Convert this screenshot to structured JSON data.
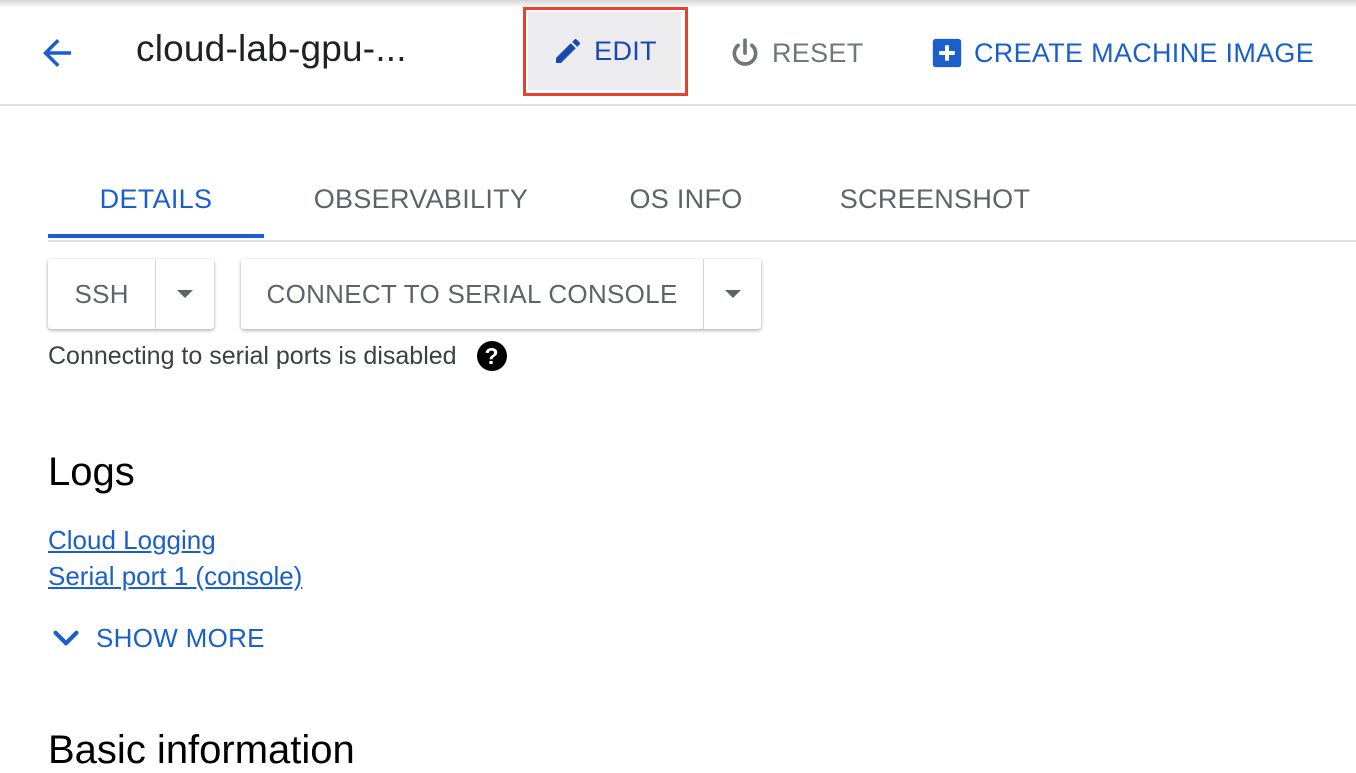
{
  "header": {
    "title": "cloud-lab-gpu-...",
    "back_icon": "arrow-back-icon",
    "actions": {
      "edit_label": "EDIT",
      "edit_icon": "pencil-icon",
      "reset_label": "RESET",
      "reset_icon": "power-icon",
      "create_label": "CREATE MACHINE IMAGE",
      "create_icon": "plus-box-icon"
    }
  },
  "tabs": [
    {
      "label": "DETAILS",
      "active": true
    },
    {
      "label": "OBSERVABILITY",
      "active": false
    },
    {
      "label": "OS INFO",
      "active": false
    },
    {
      "label": "SCREENSHOT",
      "active": false
    }
  ],
  "connect": {
    "ssh_label": "SSH",
    "serial_label": "CONNECT TO SERIAL CONSOLE",
    "serial_note": "Connecting to serial ports is disabled",
    "help_icon_glyph": "?"
  },
  "logs": {
    "heading": "Logs",
    "links": [
      "Cloud Logging",
      "Serial port 1 (console)"
    ],
    "show_more_label": "SHOW MORE"
  },
  "basic_info": {
    "heading": "Basic information"
  },
  "colors": {
    "accent": "#1a5fcc",
    "edit_text": "#1a47b0",
    "highlight_border": "#e5432f",
    "muted": "#5f6368"
  }
}
